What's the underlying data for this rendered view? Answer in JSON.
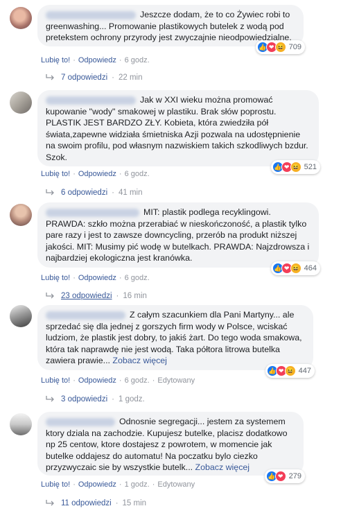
{
  "comments": [
    {
      "text": "Jeszcze dodam, że to co Żywiec robi to greenwashing... Promowanie plastikowych butelek z wodą pod pretekstem ochrony przyrody jest zwyczajnie nieodpowiedzialne.",
      "reaction_count": "709",
      "like_label": "Lubię to!",
      "reply_label": "Odpowiedz",
      "time": "6 godz.",
      "replies_label": "7 odpowiedzi",
      "replies_time": "22 min"
    },
    {
      "text": "Jak w XXI wieku można promować kupowanie \"wody\" smakowej w plastiku. Brak słów poprostu. PLASTIK JEST BARDZO ZŁY. Kobieta, która zwiedziła pół świata,zapewne widziała śmietniska Azji pozwala na udostępnienie na swoim profilu, pod własnym nazwiskiem takich szkodliwych bzdur. Szok.",
      "reaction_count": "521",
      "like_label": "Lubię to!",
      "reply_label": "Odpowiedz",
      "time": "6 godz.",
      "replies_label": "6 odpowiedzi",
      "replies_time": "41 min"
    },
    {
      "text": "MIT: plastik podlega recyklingowi. PRAWDA: szkło można przerabiać w nieskończoność, a plastik tylko pare razy i jest to zawsze downcycling, przerób na produkt niższej jakości. MIT: Musimy pić wodę w butelkach. PRAWDA: Najzdrowsza i najbardziej ekologiczna jest kranówka.",
      "reaction_count": "464",
      "like_label": "Lubię to!",
      "reply_label": "Odpowiedz",
      "time": "6 godz.",
      "replies_label": "23 odpowiedzi",
      "replies_time": "16 min"
    },
    {
      "text": "Z całym szacunkiem dla Pani Martyny... ale sprzedać się dla jednej z gorszych firm wody w Polsce, wciskać ludziom, że plastik jest dobry, to jakiś żart. Do tego woda smakowa, która tak naprawdę nie jest wodą. Taka półtora litrowa butelka zawiera prawie...",
      "see_more": "Zobacz więcej",
      "reaction_count": "447",
      "like_label": "Lubię to!",
      "reply_label": "Odpowiedz",
      "time": "6 godz.",
      "edited": "Edytowany",
      "replies_label": "3 odpowiedzi",
      "replies_time": "1 godz."
    },
    {
      "text": "Odnosnie segregacji... jestem za systemem ktory dziala na zachodzie. Kupujesz butelke, placisz dodatkowo np 25 centow, ktore dostajesz z powrotem, w momencie jak butelke oddajesz do automatu! Na poczatku bylo ciezko przyzwyczaic sie by wszystkie butelk...",
      "see_more": "Zobacz więcej",
      "reaction_count": "279",
      "like_label": "Lubię to!",
      "reply_label": "Odpowiedz",
      "time": "1 godz.",
      "edited": "Edytowany",
      "replies_label": "11 odpowiedzi",
      "replies_time": "15 min"
    }
  ],
  "colors": {
    "bubble": "#f2f3f5",
    "link": "#385898",
    "meta": "#90949c",
    "like": "#1877f2",
    "love": "#f33e58",
    "haha": "#f7b125"
  },
  "icons": [
    "like-reaction-icon",
    "love-reaction-icon",
    "haha-reaction-icon",
    "reply-arrow-icon"
  ]
}
